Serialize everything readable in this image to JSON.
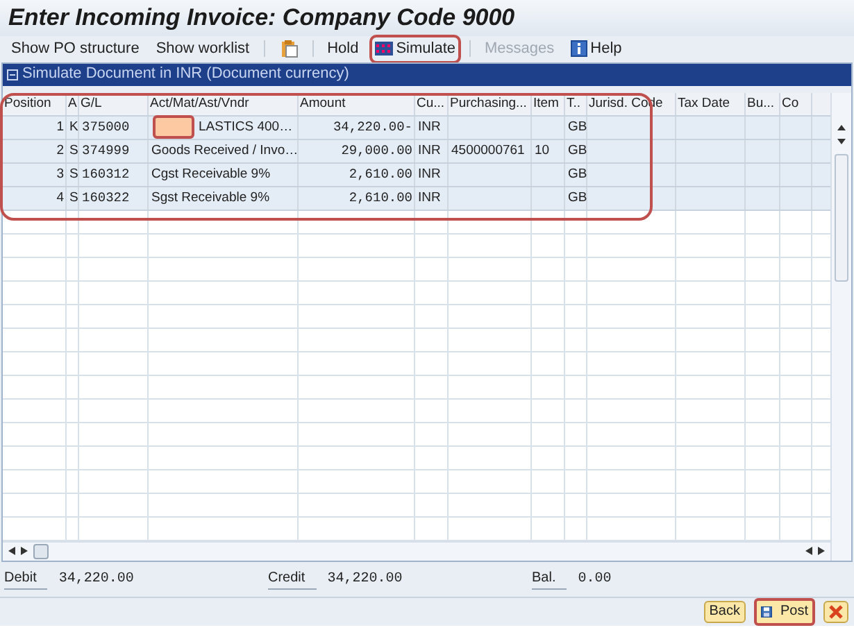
{
  "window": {
    "title": "Enter Incoming Invoice: Company Code 9000"
  },
  "toolbar": [
    {
      "kind": "text",
      "label": "Show PO structure",
      "disabled": false,
      "highlighted": false
    },
    {
      "kind": "text",
      "label": "Show worklist",
      "disabled": false,
      "highlighted": false
    },
    {
      "kind": "separator"
    },
    {
      "kind": "icon"
    },
    {
      "kind": "separator"
    },
    {
      "kind": "text",
      "label": "Hold",
      "disabled": false,
      "highlighted": false
    },
    {
      "kind": "simulate",
      "label": "Simulate",
      "disabled": false,
      "highlighted": true
    },
    {
      "kind": "separator"
    },
    {
      "kind": "text",
      "label": "Messages",
      "disabled": true,
      "highlighted": false
    },
    {
      "kind": "help",
      "label": "Help",
      "disabled": false,
      "highlighted": false
    }
  ],
  "panel": {
    "title": "Simulate Document in INR (Document currency)"
  },
  "table": {
    "highlighted": true,
    "columns": [
      "Position",
      "A",
      "G/L",
      "Act/Mat/Ast/Vndr",
      "Amount",
      "Cu...",
      "Purchasing...",
      "Item",
      "T..",
      "Jurisd. Code",
      "Tax Date",
      "Bu...",
      "Co"
    ],
    "rows": [
      {
        "cells": [
          "1",
          "K",
          "375000",
          "LASTICS 400…",
          "34,220.00-",
          "INR",
          "",
          "",
          "GB",
          "",
          "",
          "",
          ""
        ],
        "redacted": true
      },
      {
        "cells": [
          "2",
          "S",
          "374999",
          "Goods Received / Invo…",
          "29,000.00",
          "INR",
          "4500000761",
          "10",
          "GB",
          "",
          "",
          "",
          ""
        ],
        "redacted": false
      },
      {
        "cells": [
          "3",
          "S",
          "160312",
          "Cgst Receivable 9%",
          "2,610.00",
          "INR",
          "",
          "",
          "GB",
          "",
          "",
          "",
          ""
        ],
        "redacted": false
      },
      {
        "cells": [
          "4",
          "S",
          "160322",
          "Sgst Receivable 9%",
          "2,610.00",
          "INR",
          "",
          "",
          "GB",
          "",
          "",
          "",
          ""
        ],
        "redacted": false
      }
    ]
  },
  "totals": [
    {
      "label": "Debit",
      "value": "34,220.00"
    },
    {
      "label": "Credit",
      "value": "34,220.00"
    },
    {
      "label": "Bal.",
      "value": "0.00"
    }
  ],
  "footer_buttons": [
    {
      "kind": "back",
      "label": "Back",
      "highlighted": false
    },
    {
      "kind": "post",
      "label": "Post",
      "highlighted": true
    },
    {
      "kind": "cancel",
      "highlighted": false
    }
  ]
}
